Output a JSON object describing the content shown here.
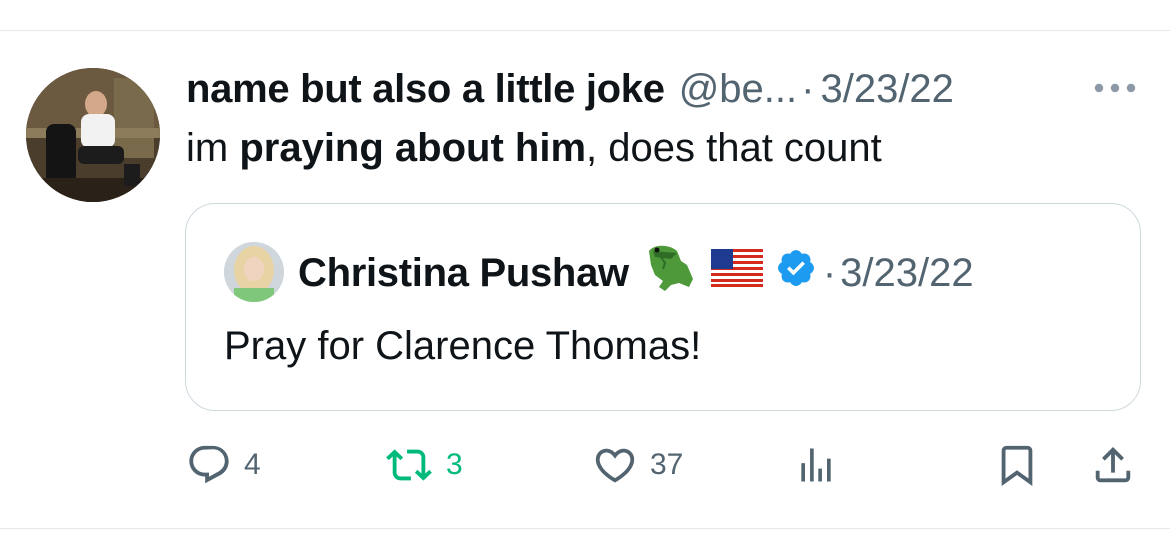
{
  "tweet": {
    "author_name": "name but also a little joke",
    "handle": "@be...",
    "separator": "·",
    "date": "3/23/22",
    "text_prefix": "im ",
    "text_bold": "praying about him",
    "text_suffix": ", does that count"
  },
  "quoted": {
    "author_name": "Christina Pushaw",
    "separator": "·",
    "date": "3/23/22",
    "text": "Pray for Clarence Thomas!",
    "icons": [
      "alligator-emoji",
      "us-flag-emoji",
      "verified-badge-icon"
    ]
  },
  "actions": {
    "replies": "4",
    "retweets": "3",
    "likes": "37"
  },
  "colors": {
    "text": "#0f1419",
    "secondary": "#536471",
    "border": "#cfd9de",
    "retweet_green": "#00ba7c",
    "verified_blue": "#1d9bf0"
  }
}
